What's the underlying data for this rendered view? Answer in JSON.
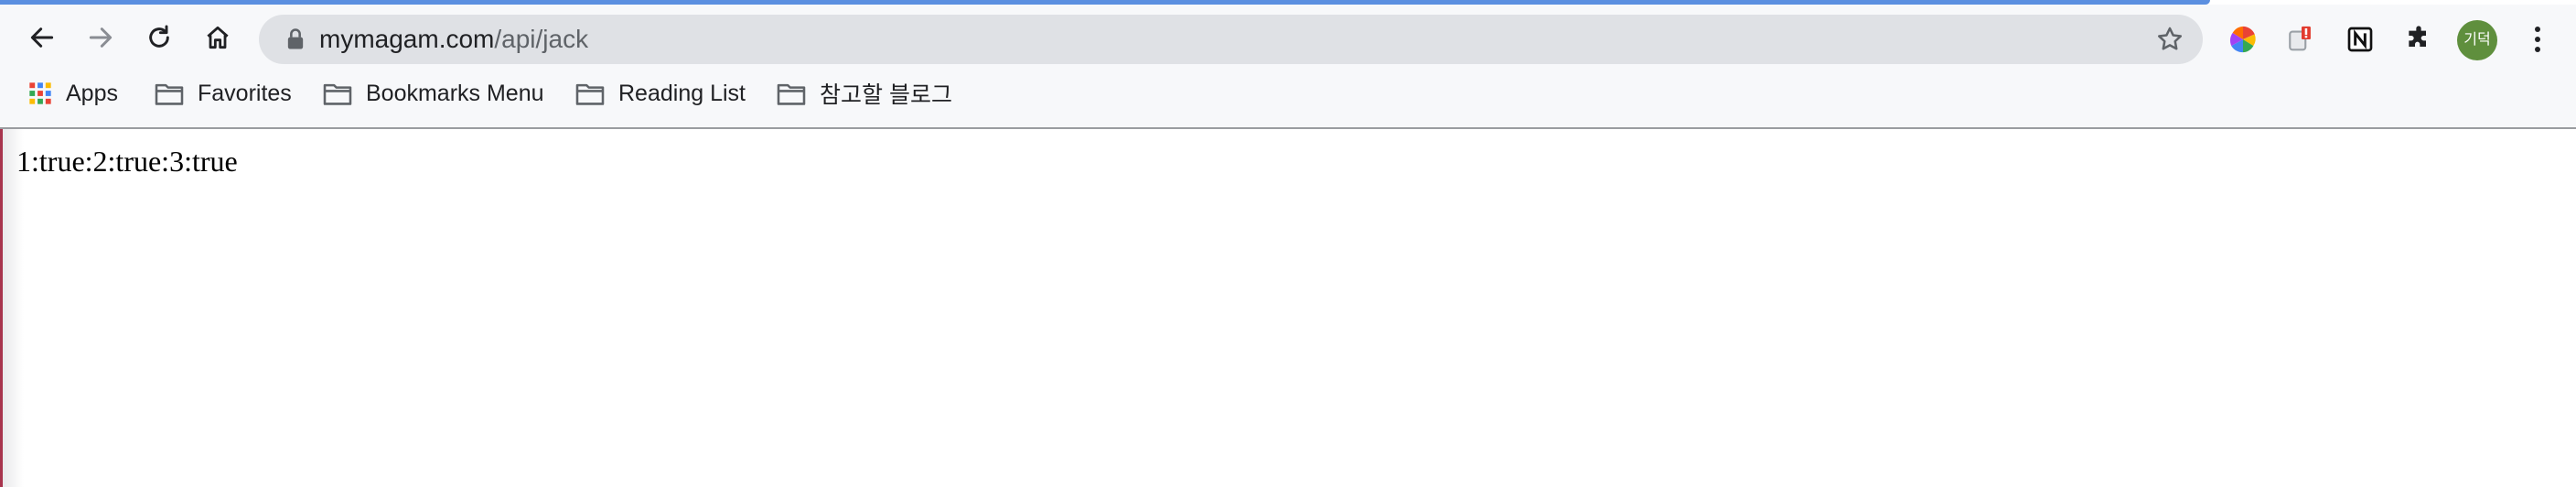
{
  "browser": {
    "url_host": "mymagam.com",
    "url_path": "/api/jack",
    "avatar_text": "기덕",
    "nav": {
      "back_icon": "arrow-left-icon",
      "forward_icon": "arrow-right-icon",
      "reload_icon": "reload-icon",
      "home_icon": "home-icon"
    },
    "extensions": [
      "color-wheel-icon",
      "puzzle-badge-icon",
      "notion-icon",
      "extensions-puzzle-icon"
    ]
  },
  "bookmarks": [
    {
      "label": "Apps",
      "icon": "apps-grid-icon"
    },
    {
      "label": "Favorites",
      "icon": "folder-icon"
    },
    {
      "label": "Bookmarks Menu",
      "icon": "folder-icon"
    },
    {
      "label": "Reading List",
      "icon": "folder-icon"
    },
    {
      "label": "참고할 블로그",
      "icon": "folder-icon"
    }
  ],
  "page": {
    "body_text": "1:true:2:true:3:true"
  },
  "colors": {
    "accent_bar": "#5b8fe0",
    "avatar_bg": "#5f8f3d"
  }
}
